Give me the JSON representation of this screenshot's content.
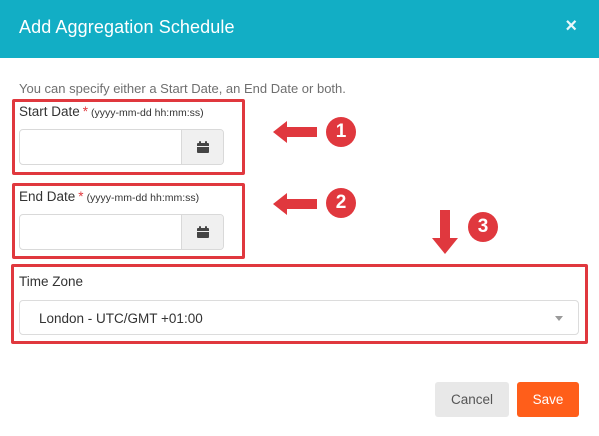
{
  "dialog": {
    "title": "Add Aggregation Schedule",
    "close_glyph": "×",
    "intro": "You can specify either a Start Date, an End Date or both."
  },
  "start_date": {
    "label": "Start Date",
    "required_mark": "*",
    "format_hint": "(yyyy-mm-dd hh:mm:ss)",
    "value": ""
  },
  "end_date": {
    "label": "End Date",
    "required_mark": "*",
    "format_hint": "(yyyy-mm-dd hh:mm:ss)",
    "value": ""
  },
  "time_zone": {
    "label": "Time Zone",
    "selected": "London - UTC/GMT +01:00"
  },
  "callouts": [
    "1",
    "2",
    "3"
  ],
  "buttons": {
    "cancel": "Cancel",
    "save": "Save"
  },
  "colors": {
    "header": "#12aec5",
    "highlight": "#e0383e",
    "save": "#ff5e1a"
  },
  "icons": {
    "calendar": "calendar-icon",
    "close": "close-icon",
    "dropdown": "caret-down-icon"
  }
}
